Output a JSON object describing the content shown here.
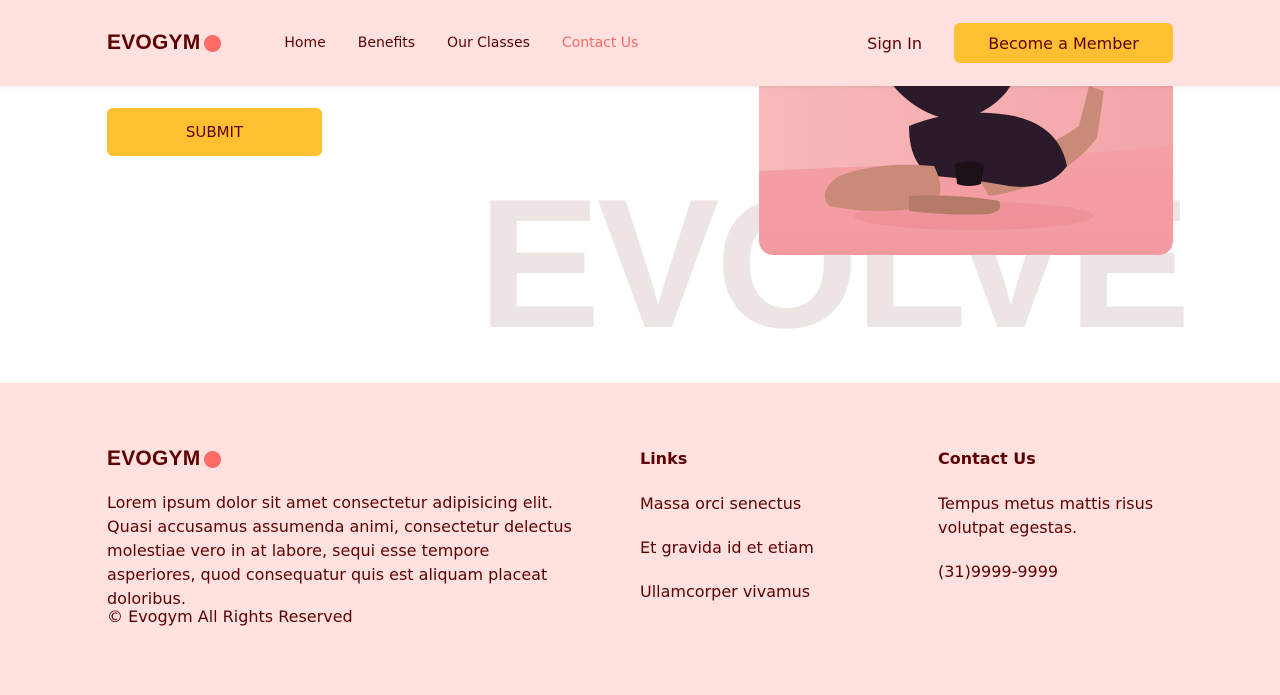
{
  "nav": {
    "logo_text": "EVOGYM",
    "links": [
      {
        "label": "Home",
        "active": false
      },
      {
        "label": "Benefits",
        "active": false
      },
      {
        "label": "Our Classes",
        "active": false
      },
      {
        "label": "Contact Us",
        "active": true
      }
    ],
    "signin_label": "Sign In",
    "member_label": "Become a Member"
  },
  "main": {
    "submit_label": "SUBMIT",
    "watermark_text": "EVOLVE"
  },
  "footer": {
    "logo_text": "EVOGYM",
    "about": "Lorem ipsum dolor sit amet consectetur adipisicing elit. Quasi accusamus assumenda animi, consectetur delectus molestiae vero in at labore, sequi esse tempore asperiores, quod consequatur quis est aliquam placeat doloribus.",
    "copyright": "© Evogym All Rights Reserved",
    "links_title": "Links",
    "links": [
      "Massa orci senectus",
      "Et gravida id et etiam",
      "Ullamcorper vivamus"
    ],
    "contact_title": "Contact Us",
    "contact_text": "Tempus metus mattis risus volutpat egestas.",
    "phone": "(31)9999-9999"
  },
  "colors": {
    "accent": "#ff6b66",
    "primary_text": "#5e0000",
    "button": "#ffc132",
    "nav_bg": "#ffe1e0"
  }
}
